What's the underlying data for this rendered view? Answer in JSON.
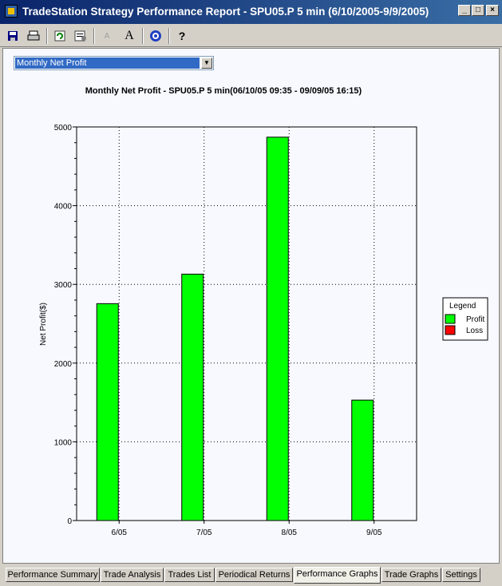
{
  "window": {
    "title": "TradeStation Strategy Performance Report - SPU05.P 5 min (6/10/2005-9/9/2005)",
    "icon": "app-icon"
  },
  "toolbar": {
    "buttons": [
      "save-icon",
      "print-icon",
      "refresh-icon",
      "properties-icon",
      "font-decrease-icon",
      "font-increase-icon",
      "target-icon",
      "help-icon"
    ]
  },
  "report_select": {
    "value": "Monthly Net Profit"
  },
  "chart_data": {
    "type": "bar",
    "title": "Monthly Net Profit - SPU05.P 5 min(06/10/05 09:35 - 09/09/05 16:15)",
    "xlabel": "",
    "ylabel": "Net Profit($)",
    "categories": [
      "6/05",
      "7/05",
      "8/05",
      "9/05"
    ],
    "series": [
      {
        "name": "Profit",
        "color": "#00ff00",
        "values": [
          2755,
          3130,
          4870,
          1530
        ]
      },
      {
        "name": "Loss",
        "color": "#ff0000",
        "values": [
          0,
          0,
          0,
          0
        ]
      }
    ],
    "ylim": [
      0,
      5000
    ],
    "yticks": [
      "0",
      "1000",
      "2000",
      "3000",
      "4000",
      "5000"
    ],
    "grid": true,
    "legend": {
      "title": "Legend",
      "placement": "right"
    }
  },
  "tabs": [
    {
      "label": "Performance Summary",
      "active": false
    },
    {
      "label": "Trade Analysis",
      "active": false
    },
    {
      "label": "Trades List",
      "active": false
    },
    {
      "label": "Periodical Returns",
      "active": false
    },
    {
      "label": "Performance Graphs",
      "active": true
    },
    {
      "label": "Trade Graphs",
      "active": false
    },
    {
      "label": "Settings",
      "active": false
    }
  ]
}
